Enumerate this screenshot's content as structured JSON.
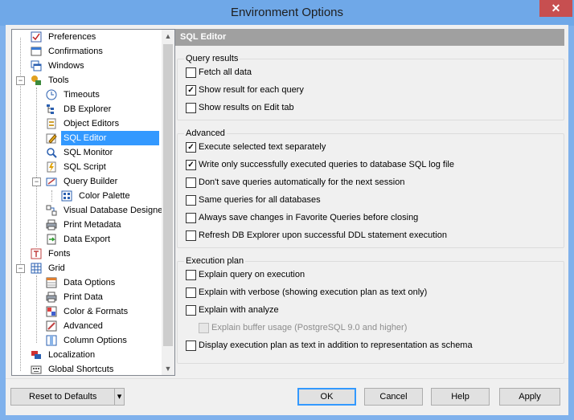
{
  "window": {
    "title": "Environment Options",
    "close_glyph": "✕"
  },
  "tree": {
    "items": [
      {
        "label": "Preferences",
        "icon": "preferences-icon"
      },
      {
        "label": "Confirmations",
        "icon": "confirmations-icon"
      },
      {
        "label": "Windows",
        "icon": "windows-icon"
      },
      {
        "label": "Tools",
        "icon": "tools-icon"
      },
      {
        "label": "Timeouts",
        "icon": "timeouts-icon"
      },
      {
        "label": "DB Explorer",
        "icon": "db-explorer-icon"
      },
      {
        "label": "Object Editors",
        "icon": "object-editors-icon"
      },
      {
        "label": "SQL Editor",
        "icon": "sql-editor-icon"
      },
      {
        "label": "SQL Monitor",
        "icon": "sql-monitor-icon"
      },
      {
        "label": "SQL Script",
        "icon": "sql-script-icon"
      },
      {
        "label": "Query Builder",
        "icon": "query-builder-icon"
      },
      {
        "label": "Color Palette",
        "icon": "color-palette-icon"
      },
      {
        "label": "Visual Database Designer",
        "icon": "visual-database-designer-icon"
      },
      {
        "label": "Print Metadata",
        "icon": "print-metadata-icon"
      },
      {
        "label": "Data Export",
        "icon": "data-export-icon"
      },
      {
        "label": "Fonts",
        "icon": "fonts-icon"
      },
      {
        "label": "Grid",
        "icon": "grid-icon"
      },
      {
        "label": "Data Options",
        "icon": "data-options-icon"
      },
      {
        "label": "Print Data",
        "icon": "print-data-icon"
      },
      {
        "label": "Color & Formats",
        "icon": "color-formats-icon"
      },
      {
        "label": "Advanced",
        "icon": "advanced-icon"
      },
      {
        "label": "Column Options",
        "icon": "column-options-icon"
      },
      {
        "label": "Localization",
        "icon": "localization-icon"
      },
      {
        "label": "Global Shortcuts",
        "icon": "global-shortcuts-icon"
      }
    ],
    "selected": "SQL Editor",
    "expand_glyph": "−"
  },
  "panel": {
    "header": "SQL Editor",
    "query_results": {
      "title": "Query results",
      "options": [
        {
          "label": "Fetch all data",
          "checked": false
        },
        {
          "label": "Show result for each query",
          "checked": true
        },
        {
          "label": "Show results on Edit tab",
          "checked": false
        }
      ]
    },
    "advanced": {
      "title": "Advanced",
      "options": [
        {
          "label": "Execute selected text separately",
          "checked": true
        },
        {
          "label": "Write only successfully executed queries to database SQL log file",
          "checked": true
        },
        {
          "label": "Don't save queries automatically for the next session",
          "checked": false
        },
        {
          "label": "Same queries for all databases",
          "checked": false
        },
        {
          "label": "Always save changes in Favorite Queries before closing",
          "checked": false
        },
        {
          "label": "Refresh DB Explorer upon successful DDL statement execution",
          "checked": false
        }
      ]
    },
    "execution_plan": {
      "title": "Execution plan",
      "options": [
        {
          "label": "Explain query on execution",
          "checked": false
        },
        {
          "label": "Explain with verbose (showing execution plan as text only)",
          "checked": false
        },
        {
          "label": "Explain with analyze",
          "checked": false
        },
        {
          "label": "Explain buffer usage (PostgreSQL 9.0 and higher)",
          "checked": false,
          "disabled": true
        },
        {
          "label": "Display execution plan as text in addition to representation as schema",
          "checked": false
        }
      ]
    }
  },
  "buttons": {
    "reset": "Reset to Defaults",
    "reset_dropdown_glyph": "▾",
    "ok": "OK",
    "cancel": "Cancel",
    "help": "Help",
    "apply": "Apply"
  },
  "check_glyph": "✓",
  "colors": {
    "selection": "#3399ff",
    "titlebar": "#6fa8e8",
    "close": "#c74f50",
    "header": "#a0a0a0"
  }
}
